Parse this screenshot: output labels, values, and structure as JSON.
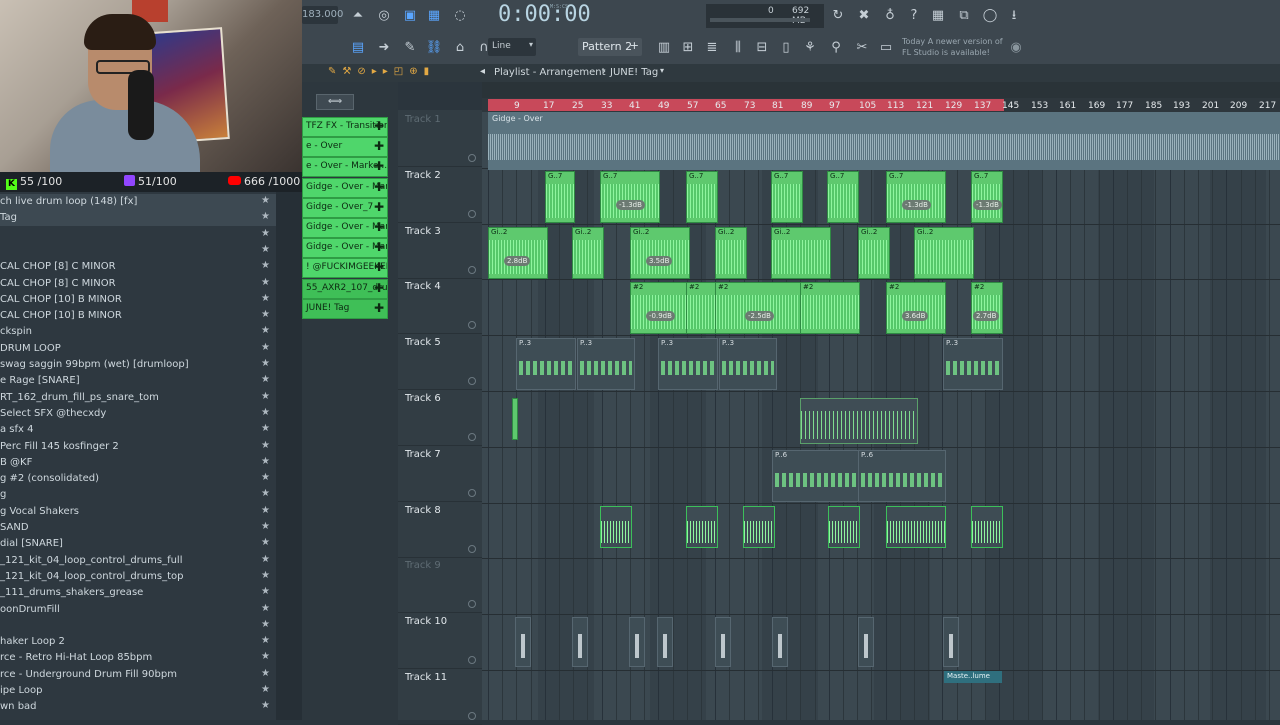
{
  "toolbar": {
    "tempo": "183.000",
    "time": "0:00:00",
    "time_unit": "M:S:CS",
    "memory": "692 MB",
    "cpu_value": "0",
    "snap": "Line",
    "pattern": "Pattern 2",
    "news_today": "Today",
    "news_line1": "A newer version of",
    "news_line2": "FL Studio is available!"
  },
  "stats": {
    "kick": "55 /100",
    "twitch": "51/100",
    "youtube": "666 /1000"
  },
  "playlist": {
    "title": "Playlist - Arrangement",
    "arrangement": "JUNE! Tag"
  },
  "ruler": [
    "9",
    "17",
    "25",
    "33",
    "41",
    "49",
    "57",
    "65",
    "73",
    "81",
    "89",
    "97",
    "105",
    "113",
    "121",
    "129",
    "137",
    "145",
    "153",
    "161",
    "169",
    "177",
    "185",
    "193",
    "201",
    "209",
    "217"
  ],
  "browser": [
    {
      "label": "ch live drum loop (148) [fx]",
      "sel": true
    },
    {
      "label": "Tag",
      "sel": true
    },
    {
      "label": "",
      "sel": false
    },
    {
      "label": "",
      "sel": false
    },
    {
      "label": "CAL CHOP [8] C MINOR",
      "sel": false
    },
    {
      "label": "CAL CHOP [8] C MINOR",
      "sel": false
    },
    {
      "label": "CAL CHOP [10] B MINOR",
      "sel": false
    },
    {
      "label": "CAL CHOP [10] B MINOR",
      "sel": false
    },
    {
      "label": "ckspin",
      "sel": false
    },
    {
      "label": " DRUM LOOP",
      "sel": false
    },
    {
      "label": " swag saggin 99bpm (wet) [drumloop]",
      "sel": false
    },
    {
      "label": "e Rage [SNARE]",
      "sel": false
    },
    {
      "label": "RT_162_drum_fill_ps_snare_tom",
      "sel": false
    },
    {
      "label": "Select SFX @thecxdy",
      "sel": false
    },
    {
      "label": "a sfx 4",
      "sel": false
    },
    {
      "label": " Perc Fill 145 kosfinger 2",
      "sel": false
    },
    {
      "label": "B @KF",
      "sel": false
    },
    {
      "label": "g #2 (consolidated)",
      "sel": false
    },
    {
      "label": "g",
      "sel": false
    },
    {
      "label": "g Vocal Shakers",
      "sel": false
    },
    {
      "label": " SAND",
      "sel": false
    },
    {
      "label": "dial [SNARE]",
      "sel": false
    },
    {
      "label": "_121_kit_04_loop_control_drums_full",
      "sel": false
    },
    {
      "label": "_121_kit_04_loop_control_drums_top",
      "sel": false
    },
    {
      "label": "_111_drums_shakers_grease",
      "sel": false
    },
    {
      "label": "oonDrumFill",
      "sel": false
    },
    {
      "label": "",
      "sel": false
    },
    {
      "label": "haker Loop 2",
      "sel": false
    },
    {
      "label": "rce - Retro Hi-Hat Loop 85bpm",
      "sel": false
    },
    {
      "label": "rce - Underground Drum Fill 90bpm",
      "sel": false
    },
    {
      "label": "ipe Loop",
      "sel": false
    },
    {
      "label": "wn bad",
      "sel": false
    }
  ],
  "picker": [
    "TFZ FX - Transition",
    "e - Over",
    "e - Over - Marke...",
    "Gidge - Over - Marke...",
    "Gidge - Over_7",
    "Gidge - Over - Marke...",
    "Gidge - Over - Marke...",
    "! @FUCKIMGEEKED -...",
    "55_AXR2_107_drums...",
    "JUNE! Tag"
  ],
  "tracks": [
    "Track 1",
    "Track 2",
    "Track 3",
    "Track 4",
    "Track 5",
    "Track 6",
    "Track 7",
    "Track 8",
    "Track 9",
    "Track 10",
    "Track 11"
  ],
  "clips": {
    "overview_label": "Gidge - Over",
    "automation_label": "Maste..lume",
    "t2_label": "G..7",
    "t3_label": "Gi..2",
    "t4_label": "#2",
    "t5_label": "P..3",
    "t7_label": "P..6",
    "db": [
      "-1.3dB",
      "-1.3dB",
      "-1.3dB",
      "2.8dB",
      "3.5dB",
      "-0.9dB",
      "-2.5dB",
      "3.6dB",
      "2.7dB"
    ]
  },
  "colors": {
    "clip": "#5ec96e",
    "ruler_play": "#c8495a",
    "bg": "#2b353d"
  }
}
